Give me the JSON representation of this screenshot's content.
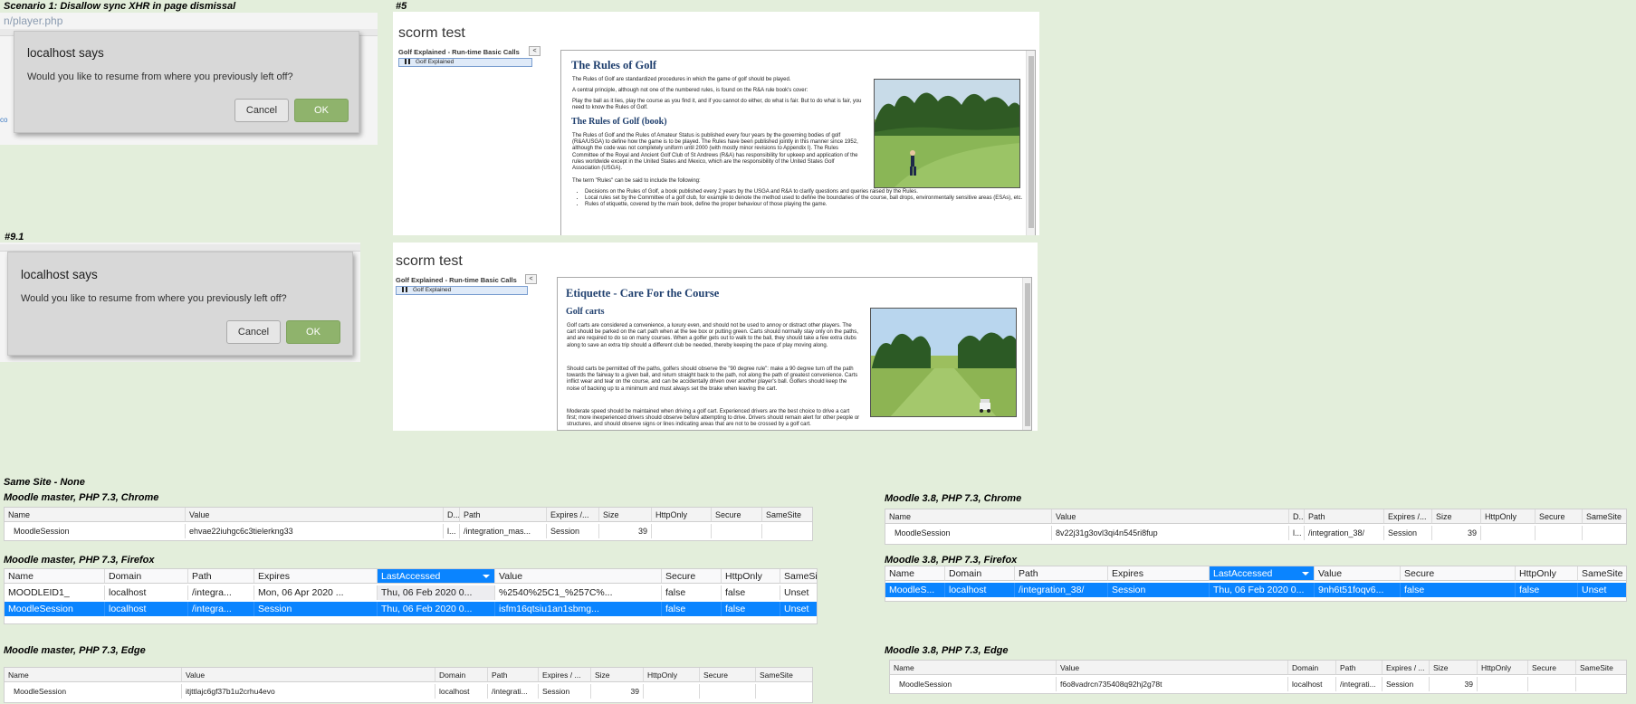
{
  "captions": {
    "scenario1": "Scenario 1: Disallow sync XHR in page dismissal",
    "n5": "#5",
    "n91": "#9.1",
    "same_site": "Same Site - None",
    "master_chrome": "Moodle master, PHP 7.3, Chrome",
    "master_firefox": "Moodle master, PHP 7.3, Firefox",
    "master_edge": "Moodle master, PHP 7.3, Edge",
    "m38_chrome": "Moodle 3.8, PHP 7.3, Chrome",
    "m38_firefox": "Moodle 3.8, PHP 7.3, Firefox",
    "m38_edge": "Moodle 3.8, PHP 7.3, Edge"
  },
  "dialog1": {
    "url": "n/player.php",
    "side": "co",
    "host": "localhost says",
    "message": "Would you like to resume from where you previously left off?",
    "cancel": "Cancel",
    "ok": "OK"
  },
  "dialog2": {
    "host": "localhost says",
    "message": "Would you like to resume from where you previously left off?",
    "cancel": "Cancel",
    "ok": "OK"
  },
  "scorm1": {
    "title": "scorm test",
    "toc_title": "Golf Explained - Run-time Basic Calls",
    "collapse": "<",
    "toc_item": "Golf Explained",
    "h1": "The Rules of Golf",
    "p1": "The Rules of Golf are standardized procedures in which the game of golf should be played.",
    "p2": "A central principle, although not one of the numbered rules, is found on the R&A rule book's cover:",
    "p3": "Play the ball as it lies, play the course as you find it, and if you cannot do either, do what is fair. But to do what is fair, you need to know the Rules of Golf.",
    "h2": "The Rules of Golf (book)",
    "p4": "The Rules of Golf and the Rules of Amateur Status is published every four years by the governing bodies of golf (R&A/USGA) to define how the game is to be played. The Rules have been published jointly in this manner since 1952, although the code was not completely uniform until 2000 (with mostly minor revisions to Appendix I). The Rules Committee of the Royal and Ancient Golf Club of St Andrews (R&A) has responsibility for upkeep and application of the rules worldwide except in the United States and Mexico, which are the responsibility of the United States Golf Association (USGA).",
    "p5": "The term \"Rules\" can be said to include the following:",
    "li1": "Decisions on the Rules of Golf, a book published every 2 years by the USGA and R&A to clarify questions and queries raised by the Rules.",
    "li2": "Local rules set by the Committee of a golf club, for example to denote the method used to define the boundaries of the course, ball drops, environmentally sensitive areas (ESAs), etc.",
    "li3": "Rules of etiquette, covered by the main book, define the proper behaviour of those playing the game."
  },
  "scorm2": {
    "title": "scorm test",
    "toc_title": "Golf Explained - Run-time Basic Calls",
    "collapse": "<",
    "toc_item": "Golf Explained",
    "h1": "Etiquette - Care For the Course",
    "h2": "Golf carts",
    "p1": "Golf carts are considered a convenience, a luxury even, and should not be used to annoy or distract other players. The cart should be parked on the cart path when at the tee box or putting green. Carts should normally stay only on the paths, and are required to do so on many courses. When a golfer gets out to walk to the ball, they should take a few extra clubs along to save an extra trip should a different club be needed, thereby keeping the pace of play moving along.",
    "p2": "Should carts be permitted off the paths, golfers should observe the \"90 degree rule\": make a 90 degree turn off the path towards the fairway to a given ball, and return straight back to the path, not along the path of greatest convenience. Carts inflict wear and tear on the course, and can be accidentally driven over another player's ball. Golfers should keep the noise of backing up to a minimum and must always set the brake when leaving the cart.",
    "p3": "Moderate speed should be maintained when driving a golf cart. Experienced drivers are the best choice to drive a cart first; more inexperienced drivers should observe before attempting to drive. Drivers should remain alert for other people or structures, and should observe signs or lines indicating areas that are not to be crossed by a golf cart."
  },
  "master_chrome": {
    "headers": [
      "Name",
      "Value",
      "D...",
      "Path",
      "Expires /...",
      "Size",
      "HttpOnly",
      "Secure",
      "SameSite"
    ],
    "rows": [
      [
        "MoodleSession",
        "ehvae22iuhgc6c3tielerkng33",
        "l...",
        "/integration_mas...",
        "Session",
        "39",
        "",
        "",
        ""
      ]
    ]
  },
  "master_firefox": {
    "headers": [
      "Name",
      "Domain",
      "Path",
      "Expires",
      "LastAccessed",
      "Value",
      "Secure",
      "HttpOnly",
      "SameSite"
    ],
    "rows": [
      [
        "MOODLEID1_",
        "localhost",
        "/integra...",
        "Mon, 06 Apr 2020 ...",
        "Thu, 06 Feb 2020 0...",
        "%2540%25C1_%257C%...",
        "false",
        "false",
        "Unset"
      ],
      [
        "MoodleSession",
        "localhost",
        "/integra...",
        "Session",
        "Thu, 06 Feb 2020 0...",
        "isfm16qtsiu1an1sbmg...",
        "false",
        "false",
        "Unset"
      ]
    ]
  },
  "master_edge": {
    "headers": [
      "Name",
      "Value",
      "Domain",
      "Path",
      "Expires / ...",
      "Size",
      "HttpOnly",
      "Secure",
      "SameSite"
    ],
    "rows": [
      [
        "MoodleSession",
        "itjttlajc6gf37b1u2crhu4evo",
        "localhost",
        "/integrati...",
        "Session",
        "39",
        "",
        "",
        ""
      ]
    ]
  },
  "m38_chrome": {
    "headers": [
      "Name",
      "Value",
      "D...",
      "Path",
      "Expires /...",
      "Size",
      "HttpOnly",
      "Secure",
      "SameSite"
    ],
    "rows": [
      [
        "MoodleSession",
        "8v22j31g3ovl3qi4n545ri8fup",
        "l...",
        "/integration_38/",
        "Session",
        "39",
        "",
        "",
        ""
      ]
    ]
  },
  "m38_firefox": {
    "headers": [
      "Name",
      "Domain",
      "Path",
      "Expires",
      "LastAccessed",
      "Value",
      "Secure",
      "HttpOnly",
      "SameSite"
    ],
    "rows": [
      [
        "MoodleS...",
        "localhost",
        "/integration_38/",
        "Session",
        "Thu, 06 Feb 2020 0...",
        "9nh6t51foqv6...",
        "false",
        "false",
        "Unset"
      ]
    ]
  },
  "m38_edge": {
    "headers": [
      "Name",
      "Value",
      "Domain",
      "Path",
      "Expires / ...",
      "Size",
      "HttpOnly",
      "Secure",
      "SameSite"
    ],
    "rows": [
      [
        "MoodleSession",
        "f6o8vadrcn735408q92hj2g78t",
        "localhost",
        "/integrati...",
        "Session",
        "39",
        "",
        "",
        ""
      ]
    ]
  }
}
